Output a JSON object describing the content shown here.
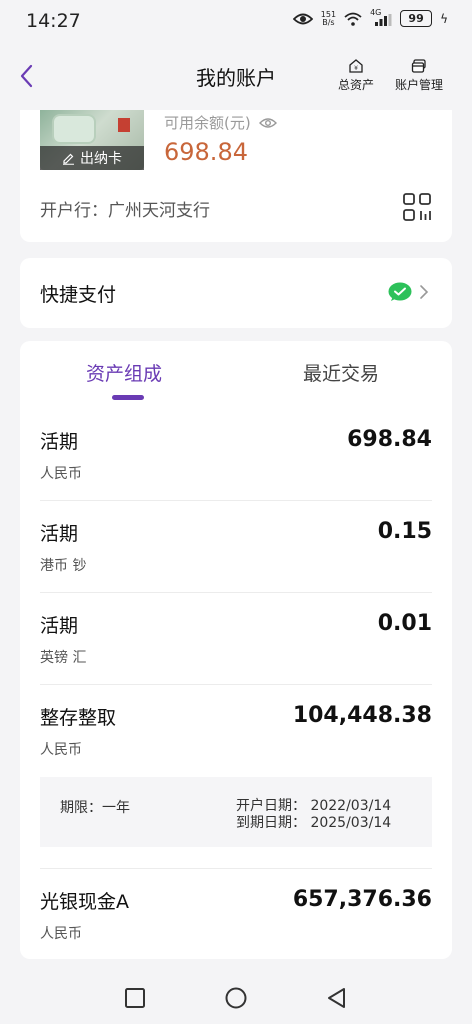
{
  "status_bar": {
    "time": "14:27",
    "net_speed_value": "151",
    "net_speed_unit": "B/s",
    "network": "4G",
    "battery": "99"
  },
  "header": {
    "title": "我的账户",
    "total_assets_label": "总资产",
    "account_manage_label": "账户管理"
  },
  "account": {
    "cashier_card_label": "出纳卡",
    "available_label": "可用余额(元)",
    "available_amount": "698.84",
    "branch_text": "开户行：广州天河支行"
  },
  "quick_pay": {
    "label": "快捷支付"
  },
  "tabs": [
    {
      "label": "资产组成",
      "active": true
    },
    {
      "label": "最近交易",
      "active": false
    }
  ],
  "assets": [
    {
      "name": "活期",
      "currency": "人民币",
      "amount": "698.84"
    },
    {
      "name": "活期",
      "currency": "港币 钞",
      "amount": "0.15"
    },
    {
      "name": "活期",
      "currency": "英镑 汇",
      "amount": "0.01"
    },
    {
      "name": "整存整取",
      "currency": "人民币",
      "amount": "104,448.38"
    },
    {
      "name": "光银现金A",
      "currency": "人民币",
      "amount": "657,376.36"
    }
  ],
  "term_deposit": {
    "term": "期限：一年",
    "open_date": "开户日期：  2022/03/14",
    "due_date": "到期日期：  2025/03/14"
  },
  "colors": {
    "accent": "#6a3bb4",
    "amount": "#c8663a",
    "wechat": "#2dc15a"
  },
  "icons": [
    "eye-icon",
    "wifi-icon",
    "signal-icon",
    "back-arrow-icon",
    "total-assets-icon",
    "account-manage-icon",
    "edit-icon",
    "qr-code-icon",
    "wechat-pay-icon",
    "chevron-right-icon",
    "square-recents-icon",
    "circle-home-icon",
    "triangle-back-icon"
  ]
}
